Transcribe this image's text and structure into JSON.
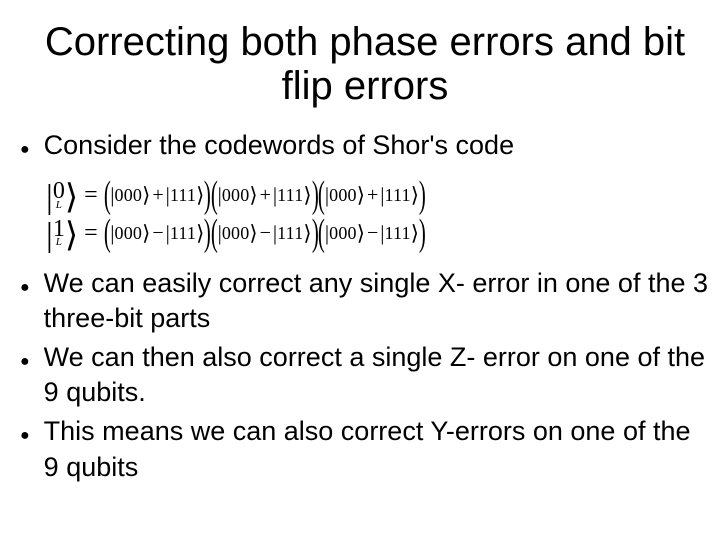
{
  "title": "Correcting both phase errors and bit flip errors",
  "bullets": {
    "b1": "Consider the codewords of Shor's code",
    "b2": "We can easily correct any single X- error in one of the 3 three-bit parts",
    "b3": "We can then also correct a single Z- error on one of the 9 qubits.",
    "b4": "This means we can also correct Y-errors on one of the 9 qubits"
  },
  "equations": {
    "ket0_main": "0",
    "ket1_main": "1",
    "ket_sub": "L",
    "eq_sign": "=",
    "basis000": "000",
    "basis111": "111",
    "plus": "+",
    "minus": "−"
  },
  "chart_data": {
    "type": "table",
    "title": "Shor's 9-qubit code logical basis (unnormalized)",
    "rows": [
      {
        "logical": "|0_L⟩",
        "state": "(|000⟩ + |111⟩)(|000⟩ + |111⟩)(|000⟩ + |111⟩)"
      },
      {
        "logical": "|1_L⟩",
        "state": "(|000⟩ − |111⟩)(|000⟩ − |111⟩)(|000⟩ − |111⟩)"
      }
    ]
  }
}
